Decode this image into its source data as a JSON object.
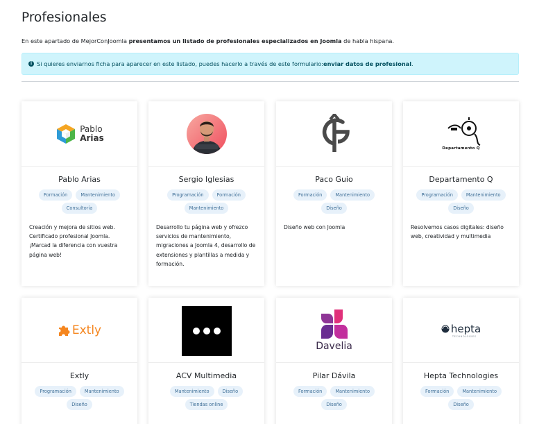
{
  "page": {
    "title": "Profesionales",
    "intro_prefix": "En este apartado de MejorConJoomla ",
    "intro_bold": "presentamos un listado de profesionales especializados en Joomla",
    "intro_suffix": " de habla hispana."
  },
  "alert": {
    "text": "Si quieres enviarnos ficha para aparecer en este listado, puedes hacerlo a través de este formulario: ",
    "link_label": "enviar datos de profesional",
    "end": ".",
    "icon": "info-circle-icon"
  },
  "logos": {
    "pablo_line1": "Pablo",
    "pablo_line2": "Arias",
    "departamento": "Departamento Q",
    "extly": "Extly",
    "davelia": "Davelia",
    "hepta": "hepta",
    "hepta_tagline": "TECHNOLOGIES"
  },
  "cards": [
    {
      "name": "Pablo Arias",
      "tags": [
        "Formación",
        "Mantenimiento",
        "Consultoría"
      ],
      "desc": "Creación y mejora de sitios web. Certificado profesional Joomla. ¡Marcad la diferencia con vuestra página web!"
    },
    {
      "name": "Sergio Iglesias",
      "tags": [
        "Programación",
        "Formación",
        "Mantenimiento"
      ],
      "desc": "Desarrollo tu página web y ofrezco servicios de mantenimiento, migraciones a Joomla 4, desarrollo de extensiones y plantillas a medida y formación."
    },
    {
      "name": "Paco Guio",
      "tags": [
        "Formación",
        "Mantenimiento",
        "Diseño"
      ],
      "desc": "Diseño web con Joomla"
    },
    {
      "name": "Departamento Q",
      "tags": [
        "Programación",
        "Mantenimiento",
        "Diseño"
      ],
      "desc": "Resolvemos casos digitales: diseño web, creatividad y multimedia"
    },
    {
      "name": "Extly",
      "tags": [
        "Programación",
        "Mantenimiento",
        "Diseño"
      ],
      "desc": ""
    },
    {
      "name": "ACV Multimedia",
      "tags": [
        "Mantenimiento",
        "Diseño",
        "Tiendas online"
      ],
      "desc": ""
    },
    {
      "name": "Pilar Dávila",
      "tags": [
        "Formación",
        "Mantenimiento",
        "Diseño"
      ],
      "desc": ""
    },
    {
      "name": "Hepta Technologies",
      "tags": [
        "Formación",
        "Mantenimiento",
        "Diseño"
      ],
      "desc": ""
    }
  ]
}
